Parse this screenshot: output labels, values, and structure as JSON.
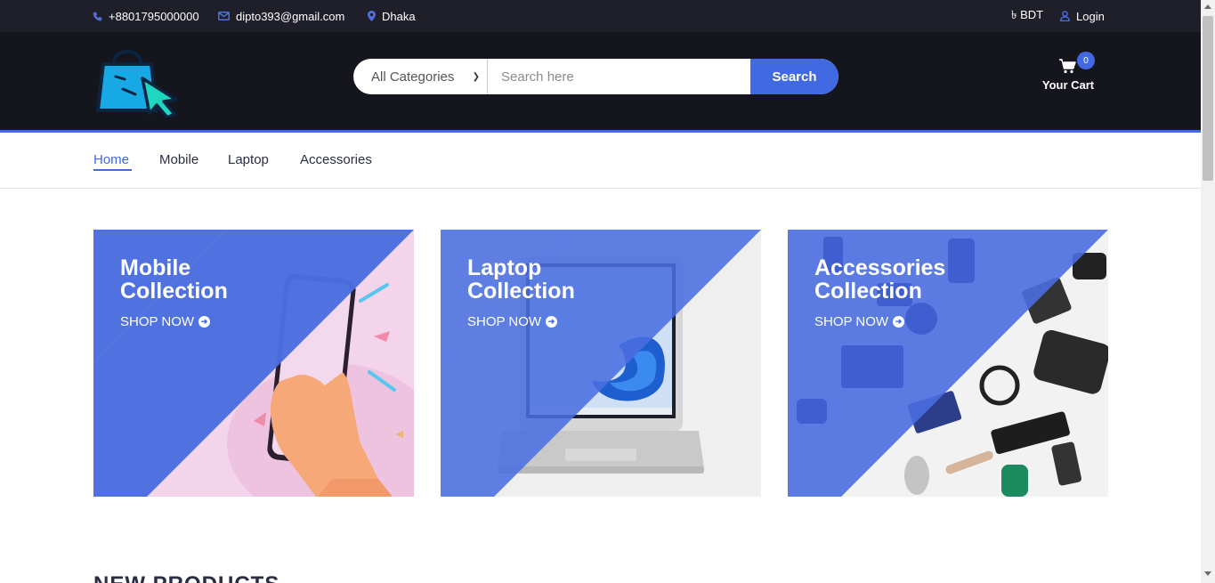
{
  "topbar": {
    "phone": "+8801795000000",
    "email": "dipto393@gmail.com",
    "location": "Dhaka",
    "currency": "৳ BDT",
    "login": "Login"
  },
  "header": {
    "search": {
      "category_selected": "All Categories",
      "placeholder": "Search here",
      "button_label": "Search"
    },
    "cart": {
      "count": "0",
      "label": "Your Cart"
    }
  },
  "nav": {
    "items": [
      {
        "label": "Home",
        "active": true
      },
      {
        "label": "Mobile",
        "active": false
      },
      {
        "label": "Laptop",
        "active": false
      },
      {
        "label": "Accessories",
        "active": false
      }
    ]
  },
  "collections": [
    {
      "line1": "Mobile",
      "line2": "Collection",
      "cta": "SHOP NOW"
    },
    {
      "line1": "Laptop",
      "line2": "Collection",
      "cta": "SHOP NOW"
    },
    {
      "line1": "Accessories",
      "line2": "Collection",
      "cta": "SHOP NOW"
    }
  ],
  "next_section": {
    "heading": "NEW PRODUCTS"
  },
  "colors": {
    "accent": "#4169e1",
    "topbar": "#1e1f29",
    "header": "#15161d",
    "card_overlay": "#4a6ee0"
  },
  "icons": {
    "phone": "phone-icon",
    "email": "envelope-icon",
    "location": "map-marker-icon",
    "user": "user-icon",
    "cart": "shopping-cart-icon",
    "logo": "shopping-bag-cursor-logo",
    "arrow": "arrow-circle-right-icon"
  }
}
